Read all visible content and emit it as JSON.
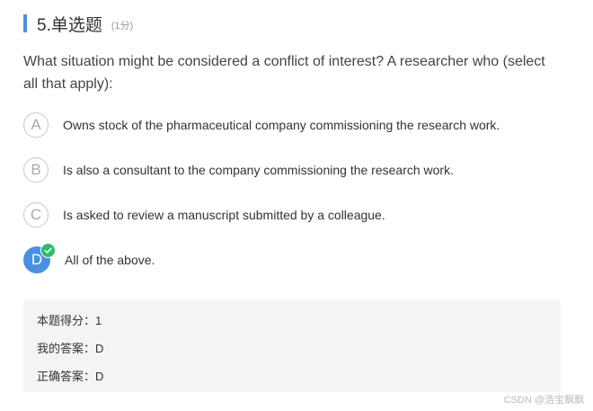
{
  "question": {
    "title": "5.单选题",
    "score": "(1分)",
    "text": "What situation might be considered a conflict of interest? A researcher who (select all that apply):"
  },
  "options": [
    {
      "letter": "A",
      "text": "Owns stock of the pharmaceutical company commissioning the research work.",
      "selected": false
    },
    {
      "letter": "B",
      "text": "Is also a consultant to the company commissioning the research work.",
      "selected": false
    },
    {
      "letter": "C",
      "text": "Is asked to review a manuscript submitted by a colleague.",
      "selected": false
    },
    {
      "letter": "D",
      "text": "All of the above.",
      "selected": true
    }
  ],
  "result": {
    "score_line": "本题得分：1",
    "my_answer_line": "我的答案：D",
    "correct_answer_line": "正确答案：D"
  },
  "watermark": "CSDN @浩宝飘飘",
  "colors": {
    "accent": "#4a90e2",
    "check": "#2dbb6d"
  },
  "icons": {
    "check": "check-icon"
  }
}
